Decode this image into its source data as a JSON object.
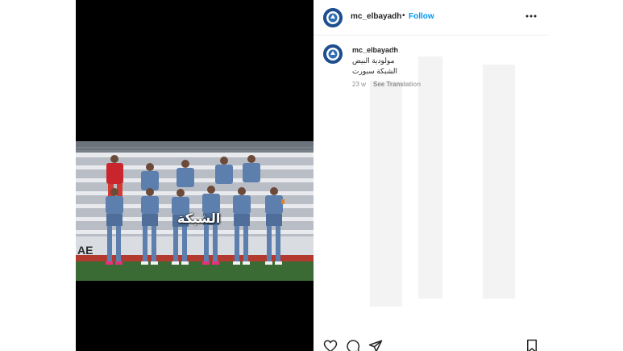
{
  "header": {
    "username": "mc_elbayadh",
    "separator": "•",
    "follow_label": "Follow",
    "more_icon": "more-horizontal-icon"
  },
  "caption": {
    "username": "mc_elbayadh",
    "time_suffix": "2...",
    "line1": "مولودية البيض",
    "line2": "الشبكة سبورت",
    "age": "23 w",
    "translate_label": "See Translation"
  },
  "photo": {
    "watermark": "الشبكة"
  },
  "actions": {
    "like_icon": "heart-icon",
    "comment_icon": "comment-icon",
    "share_icon": "share-icon",
    "save_icon": "bookmark-icon"
  },
  "colors": {
    "accent": "#0095f6",
    "media_bg": "#000000",
    "jersey": "#5d7fae",
    "pitch": "#3b6b34"
  }
}
